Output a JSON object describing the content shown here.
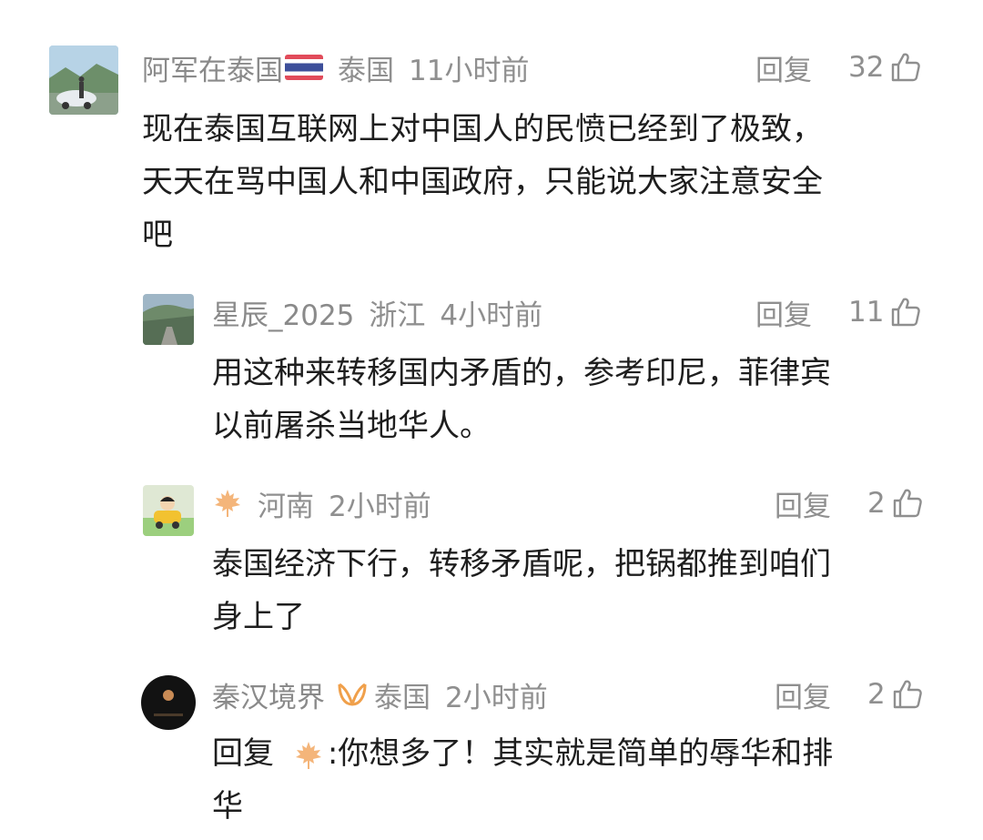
{
  "comments": [
    {
      "user": "阿军在泰国",
      "location": "泰国",
      "time": "11小时前",
      "reply_label": "回复",
      "likes": "32",
      "text_lines": [
        "现在泰国互联网上对中国人的民愤已经到了极致，",
        "天天在骂中国人和中国政府，只能说大家注意安全",
        "吧"
      ]
    },
    {
      "user": "星辰_2025",
      "location": "浙江",
      "time": "4小时前",
      "reply_label": "回复",
      "likes": "11",
      "text_lines": [
        "用这种来转移国内矛盾的，参考印尼，菲律宾",
        "以前屠杀当地华人。"
      ]
    },
    {
      "user": "",
      "location": "河南",
      "time": "2小时前",
      "reply_label": "回复",
      "likes": "2",
      "text_lines": [
        "泰国经济下行，转移矛盾呢，把锅都推到咱们",
        "身上了"
      ]
    },
    {
      "user": "秦汉境界",
      "location": "泰国",
      "time": "2小时前",
      "reply_label": "回复",
      "likes": "2",
      "reply_prefix": "回复",
      "text_lines": [
        "你想多了！其实就是简单的辱华和排",
        "华"
      ]
    }
  ],
  "icons": {
    "like": "thumbs-up-icon",
    "flag": "thailand-flag-icon",
    "leaf": "maple-leaf-icon",
    "badge": "orange-badge-icon"
  },
  "colors": {
    "meta": "#8f8f8f",
    "text": "#1e1e1e",
    "leaf": "#f4b57a"
  }
}
